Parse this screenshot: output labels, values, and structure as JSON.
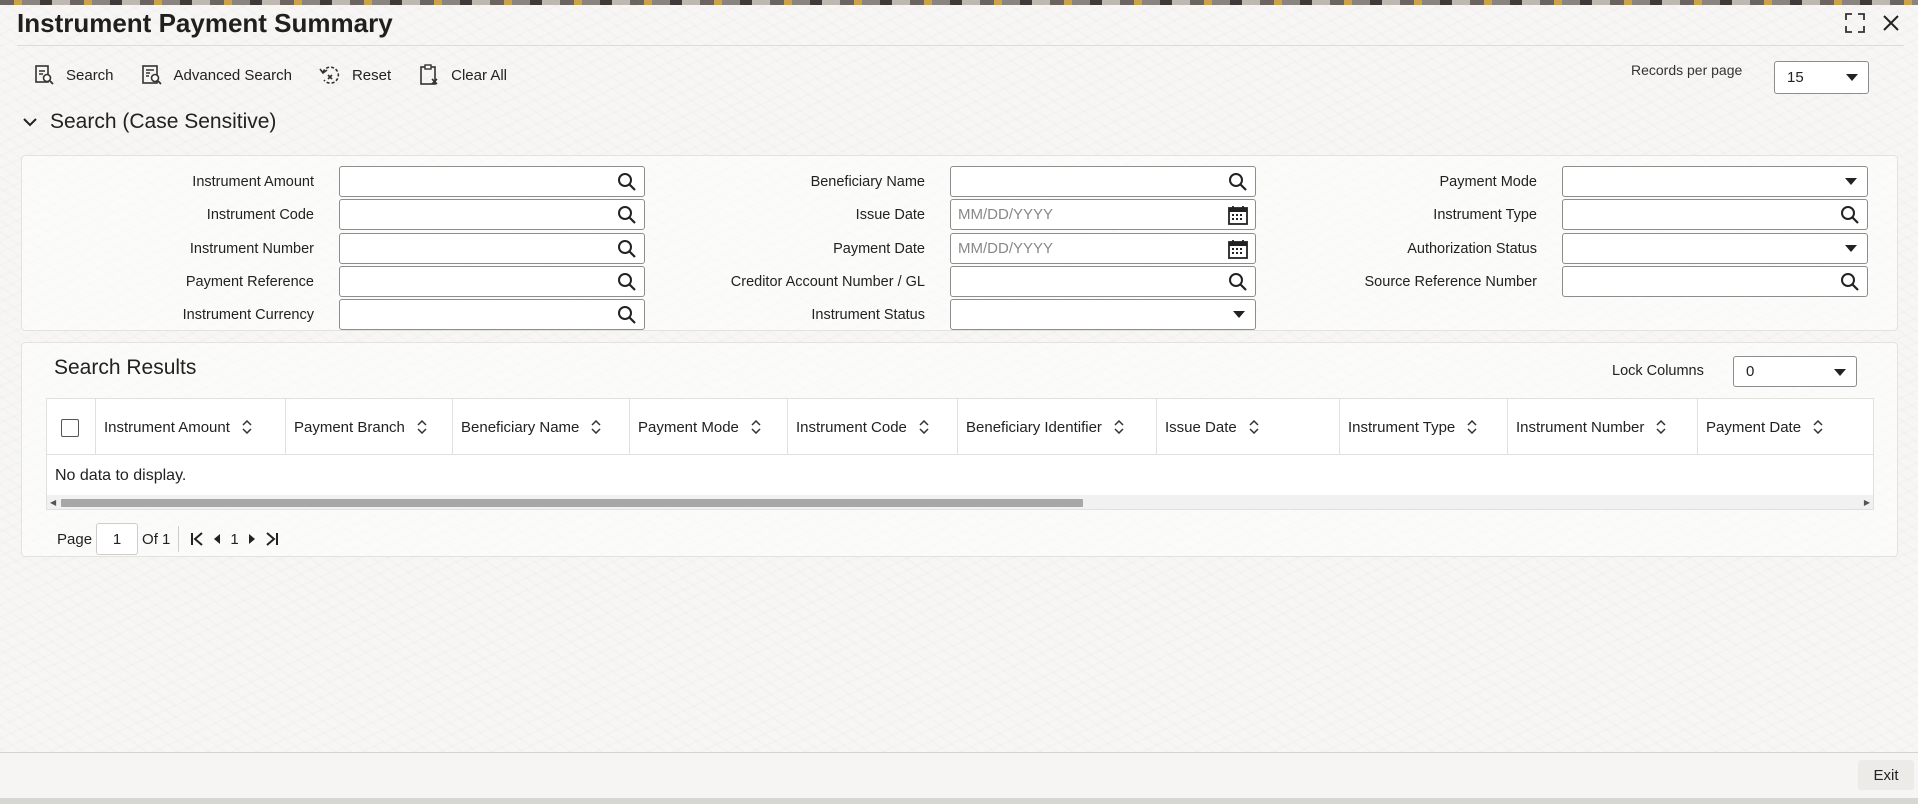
{
  "window": {
    "title": "Instrument Payment Summary"
  },
  "toolbar": {
    "search_label": "Search",
    "advanced_search_label": "Advanced Search",
    "reset_label": "Reset",
    "clear_all_label": "Clear All"
  },
  "records_per_page": {
    "label": "Records per page",
    "value": "15"
  },
  "search_section": {
    "title": "Search (Case Sensitive)"
  },
  "fields": {
    "instrument_amount": {
      "label": "Instrument Amount",
      "value": ""
    },
    "instrument_code": {
      "label": "Instrument Code",
      "value": ""
    },
    "instrument_number": {
      "label": "Instrument Number",
      "value": ""
    },
    "payment_reference": {
      "label": "Payment Reference",
      "value": ""
    },
    "instrument_currency": {
      "label": "Instrument Currency",
      "value": ""
    },
    "beneficiary_name": {
      "label": "Beneficiary Name",
      "value": ""
    },
    "issue_date": {
      "label": "Issue Date",
      "placeholder": "MM/DD/YYYY"
    },
    "payment_date": {
      "label": "Payment Date",
      "placeholder": "MM/DD/YYYY"
    },
    "creditor_account": {
      "label": "Creditor Account Number / GL",
      "value": ""
    },
    "instrument_status": {
      "label": "Instrument Status",
      "value": ""
    },
    "payment_mode": {
      "label": "Payment Mode",
      "value": ""
    },
    "instrument_type": {
      "label": "Instrument Type",
      "value": ""
    },
    "authorization_status": {
      "label": "Authorization Status",
      "value": ""
    },
    "source_reference_number": {
      "label": "Source Reference Number",
      "value": ""
    }
  },
  "results": {
    "title": "Search Results",
    "lock_columns_label": "Lock Columns",
    "lock_columns_value": "0",
    "columns": [
      "Instrument Amount",
      "Payment Branch",
      "Beneficiary Name",
      "Payment Mode",
      "Instrument Code",
      "Beneficiary Identifier",
      "Issue Date",
      "Instrument Type",
      "Instrument Number",
      "Payment Date"
    ],
    "empty_message": "No data to display."
  },
  "pagination": {
    "page_label": "Page",
    "current_page": "1",
    "of_label": "Of 1",
    "page_link": "1"
  },
  "footer": {
    "exit_label": "Exit"
  },
  "icons": {
    "search": "search-icon",
    "calendar": "calendar-icon",
    "dropdown": "chevron-down-icon"
  }
}
